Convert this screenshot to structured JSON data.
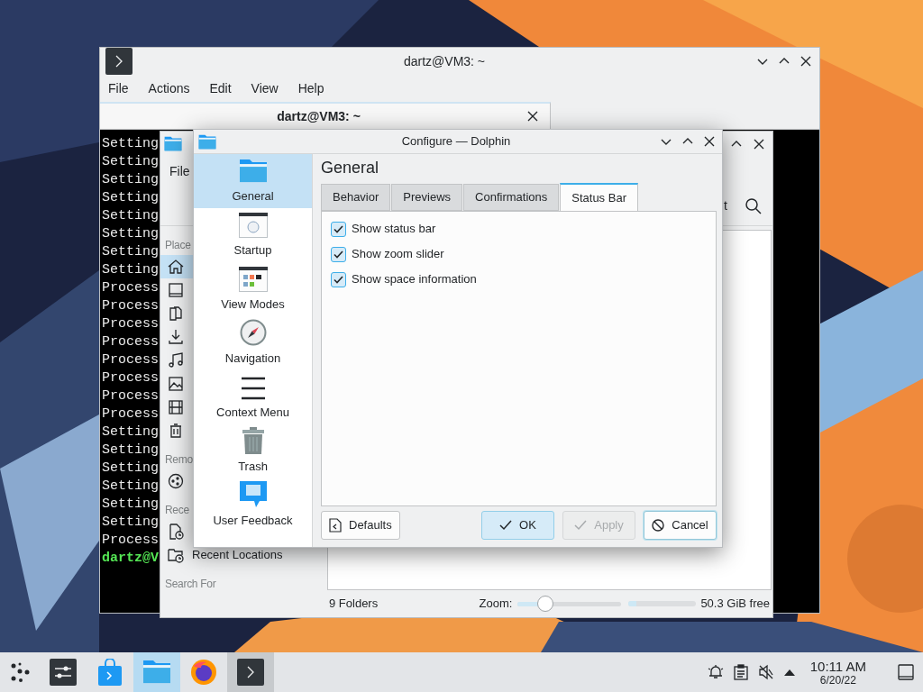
{
  "terminal_window": {
    "title": "dartz@VM3: ~",
    "menu": [
      "File",
      "Actions",
      "Edit",
      "View",
      "Help"
    ],
    "tabs": [
      {
        "label": "dartz@VM3: ~",
        "selected": true
      }
    ],
    "lines": [
      {
        "text": "Setting",
        "kind": "output"
      },
      {
        "text": "Setting",
        "kind": "output"
      },
      {
        "text": "Setting",
        "kind": "output"
      },
      {
        "text": "Setting",
        "kind": "output"
      },
      {
        "text": "Setting",
        "kind": "output"
      },
      {
        "text": "Setting",
        "kind": "output"
      },
      {
        "text": "Setting",
        "kind": "output"
      },
      {
        "text": "Setting",
        "kind": "output"
      },
      {
        "text": "Process",
        "kind": "output"
      },
      {
        "text": "Process",
        "kind": "output"
      },
      {
        "text": "Process",
        "kind": "output"
      },
      {
        "text": "Process",
        "kind": "output"
      },
      {
        "text": "Process",
        "kind": "output"
      },
      {
        "text": "Process",
        "kind": "output"
      },
      {
        "text": "Process",
        "kind": "output"
      },
      {
        "text": "Process",
        "kind": "output"
      },
      {
        "text": "Setting",
        "kind": "output"
      },
      {
        "text": "Setting",
        "kind": "output"
      },
      {
        "text": "Setting",
        "kind": "output"
      },
      {
        "text": "Setting",
        "kind": "output"
      },
      {
        "text": "Setting",
        "kind": "output"
      },
      {
        "text": "Setting",
        "kind": "output"
      },
      {
        "text": "Process",
        "kind": "output"
      },
      {
        "text": "dartz@V",
        "kind": "prompt"
      }
    ]
  },
  "dolphin_window": {
    "menu": [
      "File"
    ],
    "toolbar_text": "t",
    "places": [
      {
        "heading": "Place",
        "items": [
          {
            "kind": "home",
            "selected": true
          },
          {
            "kind": "desktop",
            "selected": false
          },
          {
            "kind": "documents",
            "selected": false
          },
          {
            "kind": "downloads",
            "selected": false
          },
          {
            "kind": "music",
            "selected": false
          },
          {
            "kind": "pictures",
            "selected": false
          },
          {
            "kind": "videos",
            "selected": false
          },
          {
            "kind": "trash",
            "selected": false
          }
        ]
      },
      {
        "heading": "Remo",
        "items": [
          {
            "kind": "network",
            "selected": false
          }
        ]
      },
      {
        "heading": "Rece",
        "items": [
          {
            "kind": "recent-files",
            "selected": false
          },
          {
            "kind": "recent-locations",
            "label": "Recent Locations",
            "selected": false
          }
        ]
      },
      {
        "heading": "Search For"
      }
    ],
    "status_bar": {
      "count": "9 Folders",
      "zoom_label": "Zoom:",
      "zoom": {
        "level": 0.27
      },
      "space": {
        "level": 0.12
      },
      "free": "50.3 GiB free"
    }
  },
  "dialog": {
    "title": "Configure — Dolphin",
    "pages": [
      {
        "kind": "folder",
        "label": "General",
        "selected": true
      },
      {
        "kind": "window",
        "label": "Startup",
        "selected": false
      },
      {
        "kind": "view-modes",
        "label": "View Modes",
        "selected": false
      },
      {
        "kind": "compass",
        "label": "Navigation",
        "selected": false
      },
      {
        "kind": "menu",
        "label": "Context Menu",
        "selected": false
      },
      {
        "kind": "trash",
        "label": "Trash",
        "selected": false
      },
      {
        "kind": "feedback",
        "label": "User Feedback",
        "selected": false
      }
    ],
    "heading": "General",
    "tabs": [
      {
        "label": "Behavior",
        "selected": false
      },
      {
        "label": "Previews",
        "selected": false
      },
      {
        "label": "Confirmations",
        "selected": false
      },
      {
        "label": "Status Bar",
        "selected": true
      }
    ],
    "options": [
      {
        "label": "Show status bar",
        "checked": true
      },
      {
        "label": "Show zoom slider",
        "checked": true
      },
      {
        "label": "Show space information",
        "checked": true
      }
    ],
    "buttons": [
      {
        "kind": "defaults",
        "label": "Defaults",
        "disabled": false
      },
      {
        "kind": "ok",
        "label": "OK",
        "disabled": false
      },
      {
        "kind": "apply",
        "label": "Apply",
        "disabled": true
      },
      {
        "kind": "cancel",
        "label": "Cancel",
        "disabled": false
      }
    ]
  },
  "taskbar": {
    "tasks": [
      {
        "kind": "launcher",
        "selected": false,
        "open": false
      },
      {
        "kind": "settings",
        "selected": false,
        "open": false
      },
      {
        "kind": "store",
        "selected": false,
        "open": false
      },
      {
        "kind": "files",
        "selected": true
      },
      {
        "kind": "browser",
        "selected": false,
        "open": false
      },
      {
        "kind": "terminal",
        "selected": false,
        "open": true
      }
    ],
    "clock": {
      "time": "10:11 AM",
      "date": "6/20/22"
    }
  }
}
